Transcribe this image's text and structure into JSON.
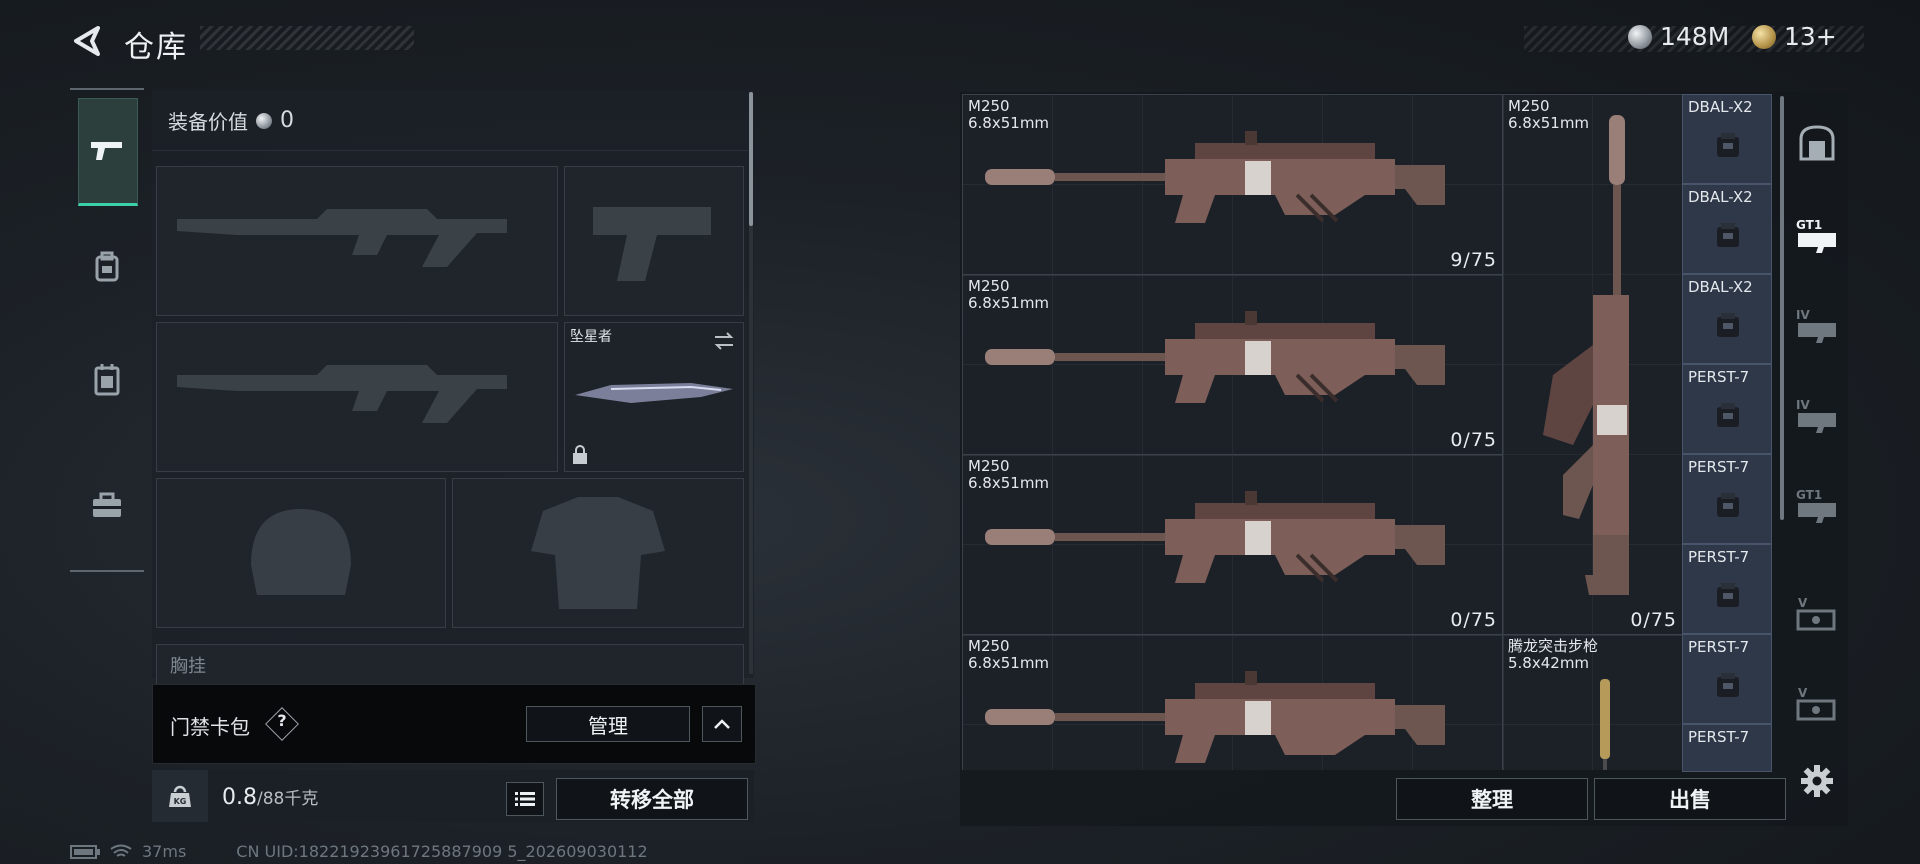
{
  "header": {
    "title": "仓库"
  },
  "currencies": [
    {
      "icon": "silver-coin-icon",
      "value": "148M",
      "color": "#c9ced3"
    },
    {
      "icon": "gold-coin-icon",
      "value": "13+",
      "color": "#c7a75a"
    }
  ],
  "left_rail": {
    "items": [
      {
        "icon": "pistol-icon",
        "active": true
      },
      {
        "icon": "backpack-icon",
        "active": false
      },
      {
        "icon": "chest-rig-icon",
        "active": false
      },
      {
        "icon": "toolbox-icon",
        "active": false
      }
    ]
  },
  "equipment": {
    "value_label": "装备价值",
    "value": "0",
    "melee_name": "坠星者",
    "chest_label": "胸挂"
  },
  "keycard": {
    "label": "门禁卡包",
    "help": "?",
    "manage_label": "管理"
  },
  "weight": {
    "current": "0.8",
    "max": "/88千克"
  },
  "transfer_all_label": "转移全部",
  "status": {
    "ping": "37ms",
    "uid": "CN UID:18221923961725887909 5_202609030112"
  },
  "stash": {
    "items": [
      {
        "name": "M250",
        "caliber": "6.8x51mm",
        "count": "9/75"
      },
      {
        "name": "M250",
        "caliber": "6.8x51mm",
        "count": "0/75"
      },
      {
        "name": "M250",
        "caliber": "6.8x51mm",
        "count": "0/75"
      },
      {
        "name": "M250",
        "caliber": "6.8x51mm",
        "count": ""
      },
      {
        "name": "M250",
        "caliber": "6.8x51mm",
        "count": "0/75"
      },
      {
        "name": "腾龙突击步枪",
        "caliber": "5.8x42mm",
        "count": ""
      }
    ],
    "scopes": [
      "DBAL-X2",
      "DBAL-X2",
      "DBAL-X2",
      "PERST-7",
      "PERST-7",
      "PERST-7",
      "PERST-7",
      "PERST-7"
    ],
    "sort_label": "整理",
    "sell_label": "出售"
  },
  "right_rail": {
    "items": [
      {
        "icon": "safe-box-icon"
      },
      {
        "label": "GT1"
      },
      {
        "label": "IV"
      },
      {
        "label": "IV"
      },
      {
        "label": "GT1"
      },
      {
        "label": "V"
      },
      {
        "label": "V"
      }
    ]
  }
}
